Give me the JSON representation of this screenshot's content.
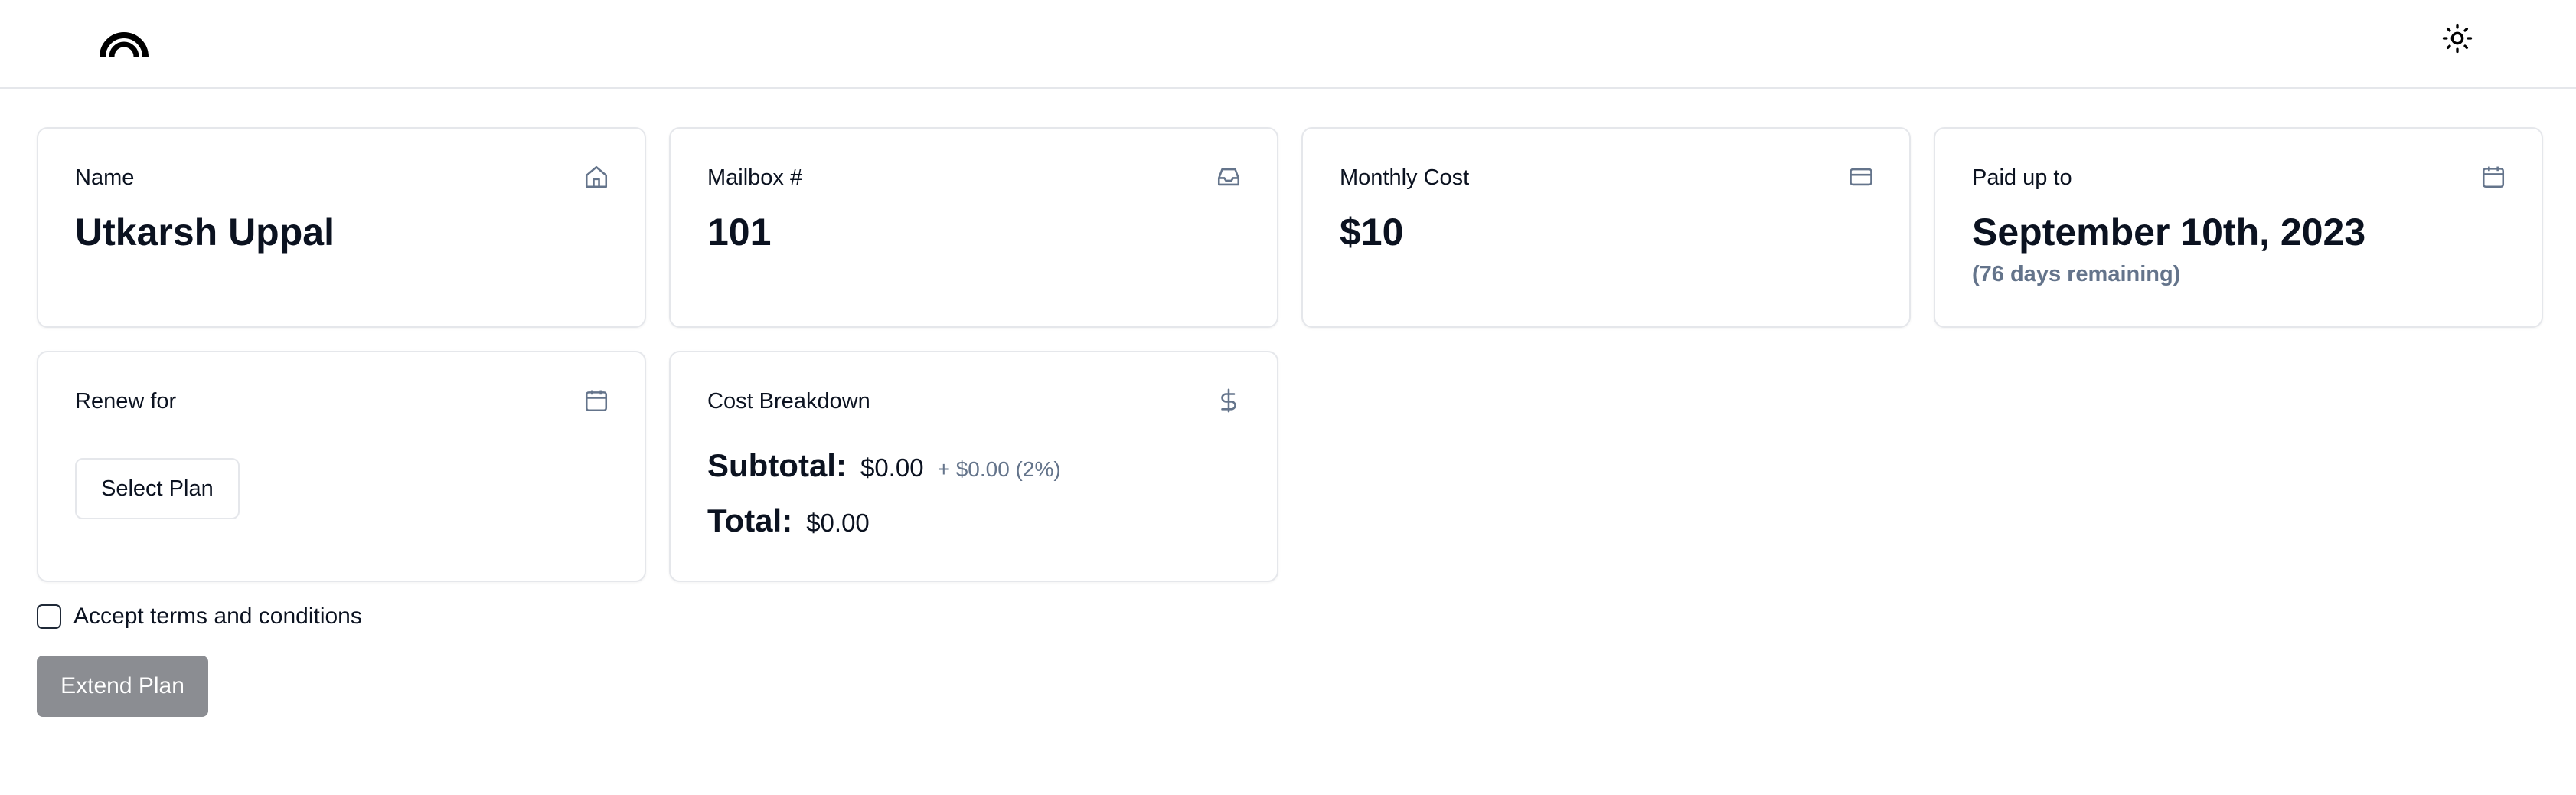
{
  "header": {
    "logo_icon": "arch-logo-icon",
    "theme_toggle_icon": "sun-icon"
  },
  "cards": {
    "name": {
      "label": "Name",
      "value": "Utkarsh Uppal",
      "icon": "home-icon"
    },
    "mailbox": {
      "label": "Mailbox #",
      "value": "101",
      "icon": "inbox-icon"
    },
    "monthly_cost": {
      "label": "Monthly Cost",
      "value": "$10",
      "icon": "credit-card-icon"
    },
    "paid_up_to": {
      "label": "Paid up to",
      "value": "September 10th, 2023",
      "sub": "(76 days remaining)",
      "icon": "calendar-icon"
    },
    "renew_for": {
      "label": "Renew for",
      "button_label": "Select Plan",
      "icon": "calendar-icon"
    },
    "cost_breakdown": {
      "label": "Cost Breakdown",
      "icon": "dollar-sign-icon",
      "subtotal_label": "Subtotal:",
      "subtotal_value": "$0.00",
      "fee_text": "+ $0.00 (2%)",
      "total_label": "Total:",
      "total_value": "$0.00"
    }
  },
  "terms": {
    "label": "Accept terms and conditions",
    "checked": false
  },
  "actions": {
    "extend_label": "Extend Plan"
  },
  "colors": {
    "border": "#e5e7eb",
    "text": "#0b1220",
    "muted": "#64748b",
    "disabled_button": "#8b8d92"
  }
}
